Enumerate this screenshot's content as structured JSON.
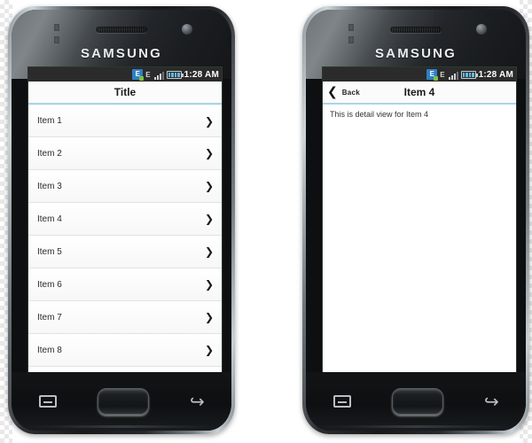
{
  "page": {
    "background_color": "#ffffff",
    "checker_color": "#e8e8e8"
  },
  "phones": [
    {
      "id": "list-phone",
      "brand_logo": "SAMSUNG",
      "icons": {
        "speaker": "speaker-grille-icon",
        "camera": "front-camera-icon",
        "sensor": "proximity-sensor-icon"
      },
      "statusbar": {
        "data_icon": "edge-data-icon",
        "data_letter": "E",
        "signal_letter": "E",
        "signal_icon": "signal-bars-icon",
        "battery_icon": "battery-icon",
        "time": "1:28 AM"
      },
      "navbar": {
        "title": "Title"
      },
      "list": {
        "chevron": "❯",
        "items": [
          {
            "label": "Item 1"
          },
          {
            "label": "Item 2"
          },
          {
            "label": "Item 3"
          },
          {
            "label": "Item 4"
          },
          {
            "label": "Item 5"
          },
          {
            "label": "Item 6"
          },
          {
            "label": "Item 7"
          },
          {
            "label": "Item 8"
          }
        ]
      },
      "hardware": {
        "menu_key": "menu-key-icon",
        "home_button": "home-button",
        "back_key": "↩"
      }
    },
    {
      "id": "detail-phone",
      "brand_logo": "SAMSUNG",
      "icons": {
        "speaker": "speaker-grille-icon",
        "camera": "front-camera-icon",
        "sensor": "proximity-sensor-icon"
      },
      "statusbar": {
        "data_icon": "edge-data-icon",
        "data_letter": "E",
        "signal_letter": "E",
        "signal_icon": "signal-bars-icon",
        "battery_icon": "battery-icon",
        "time": "1:28 AM"
      },
      "navbar": {
        "back_chevron": "❮",
        "back_label": "Back",
        "title": "Item 4"
      },
      "detail": {
        "text": "This is detail view for Item 4"
      },
      "hardware": {
        "menu_key": "menu-key-icon",
        "home_button": "home-button",
        "back_key": "↩"
      }
    }
  ],
  "colors": {
    "navbar_underline": "#a8d5ea",
    "statusbar_bg": "#2b2b2b",
    "screen_bg": "#ffffff",
    "row_divider": "#e2e2e2",
    "text_primary": "#2b2b2b"
  }
}
